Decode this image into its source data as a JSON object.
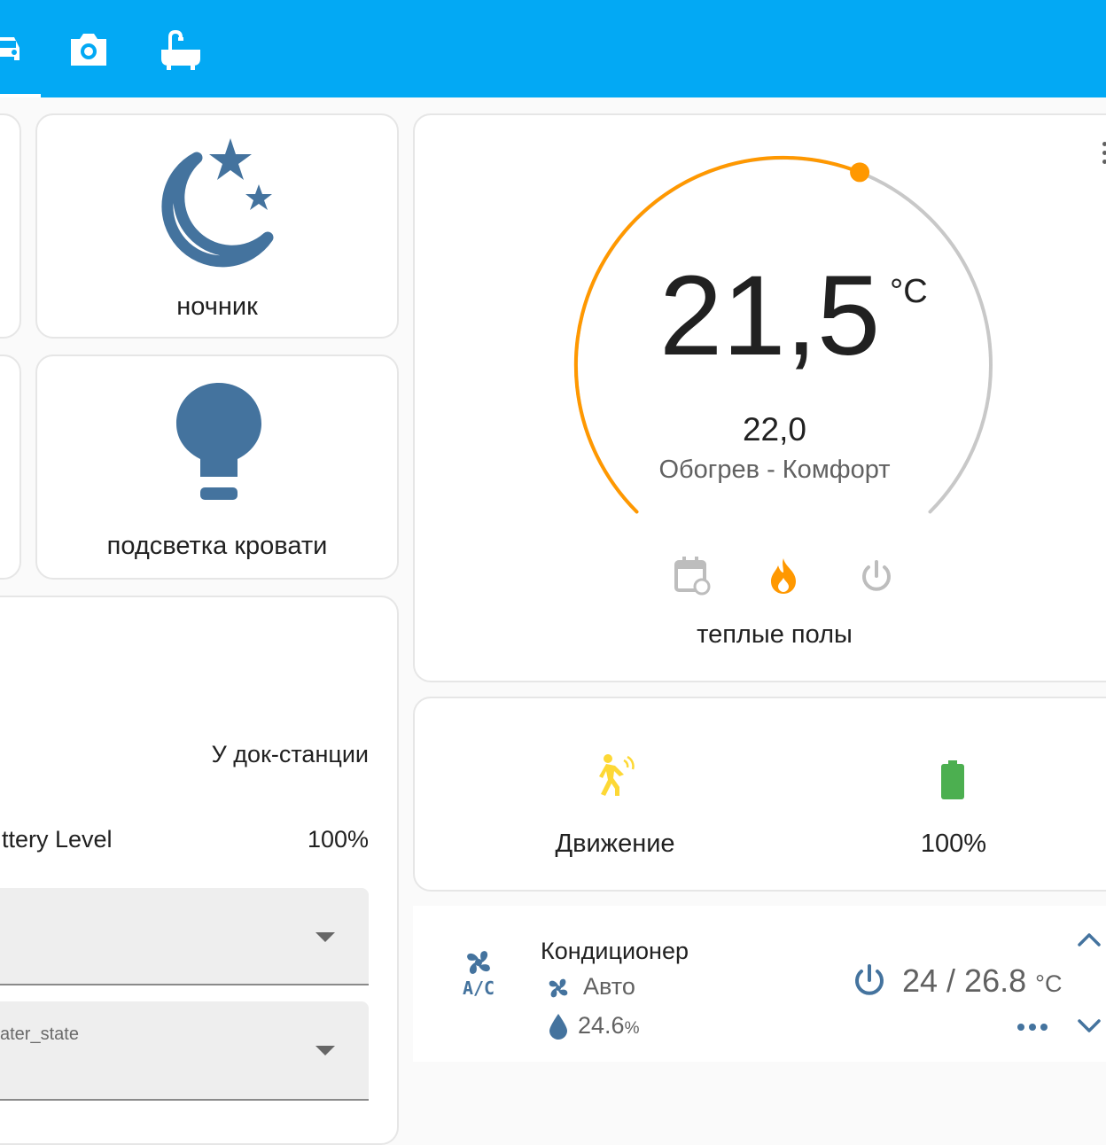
{
  "colors": {
    "header": "#03a9f4",
    "icon_blue": "#44739e",
    "heat_orange": "#ff9800",
    "arc_gray": "#c8c8c8",
    "battery_green": "#4caf50",
    "motion_yellow": "#fdd835"
  },
  "header": {
    "tabs": [
      {
        "icon": "car-icon"
      },
      {
        "icon": "camera-icon"
      },
      {
        "icon": "bathtub-icon"
      }
    ]
  },
  "buttons": {
    "night_light": {
      "icon": "moon-stars-icon",
      "label": "ночник"
    },
    "bed_light": {
      "icon": "lightbulb-icon",
      "label": "подсветка кровати"
    }
  },
  "vacuum": {
    "status": "У док-станции",
    "battery_label": "ttery Level",
    "battery_value": "100%",
    "select2_label": "ater_state"
  },
  "thermostat": {
    "current": "21,5",
    "unit": "°C",
    "target": "22,0",
    "mode": "Обогрев - Комфорт",
    "name": "теплые полы",
    "target_fraction": 0.58,
    "mode_buttons": [
      {
        "icon": "calendar-sync-icon",
        "active": false
      },
      {
        "icon": "fire-icon",
        "active": true
      },
      {
        "icon": "power-icon",
        "active": false
      }
    ]
  },
  "sensors": {
    "motion": {
      "icon": "motion-sensor-icon",
      "label": "Движение"
    },
    "battery": {
      "icon": "battery-icon",
      "value": "100%"
    }
  },
  "climate": {
    "name": "Кондиционер",
    "fan_mode": "Авто",
    "humidity": "24.6",
    "humidity_unit": "%",
    "temps": "24 / 26.8",
    "temp_unit": "°C"
  }
}
